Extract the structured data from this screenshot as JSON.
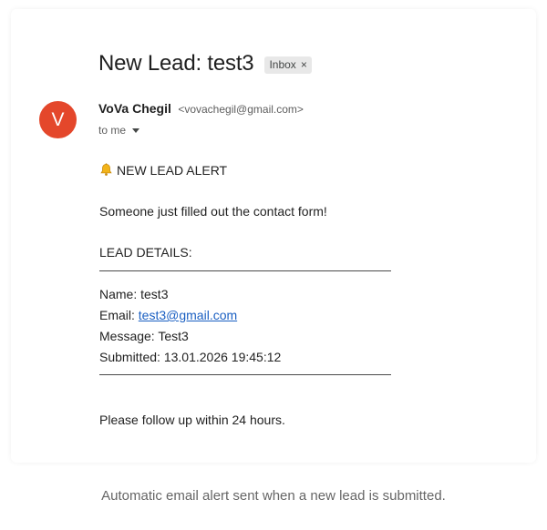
{
  "email": {
    "subject": "New Lead: test3",
    "label_chip": "Inbox",
    "label_chip_close": "×",
    "sender": {
      "avatar_letter": "V",
      "avatar_color": "#e4472b",
      "name": "VoVa Chegil",
      "email": "<vovachegil@gmail.com>"
    },
    "recipient_line": "to me",
    "body": {
      "alert_icon": "bell-icon",
      "alert_title": "NEW LEAD ALERT",
      "intro": "Someone just filled out the contact form!",
      "details_heading": "LEAD DETAILS:",
      "name_label": "Name: ",
      "name_value": "test3",
      "email_label": "Email: ",
      "email_value": "test3@gmail.com",
      "message_label": "Message: ",
      "message_value": "Test3",
      "submitted_label": "Submitted: ",
      "submitted_value": "13.01.2026 19:45:12",
      "closing": "Please follow up within 24 hours."
    }
  },
  "caption": "Automatic email alert sent when a new lead is submitted.",
  "colors": {
    "link": "#1a5fc2",
    "chip_background": "#e8e8e8"
  }
}
